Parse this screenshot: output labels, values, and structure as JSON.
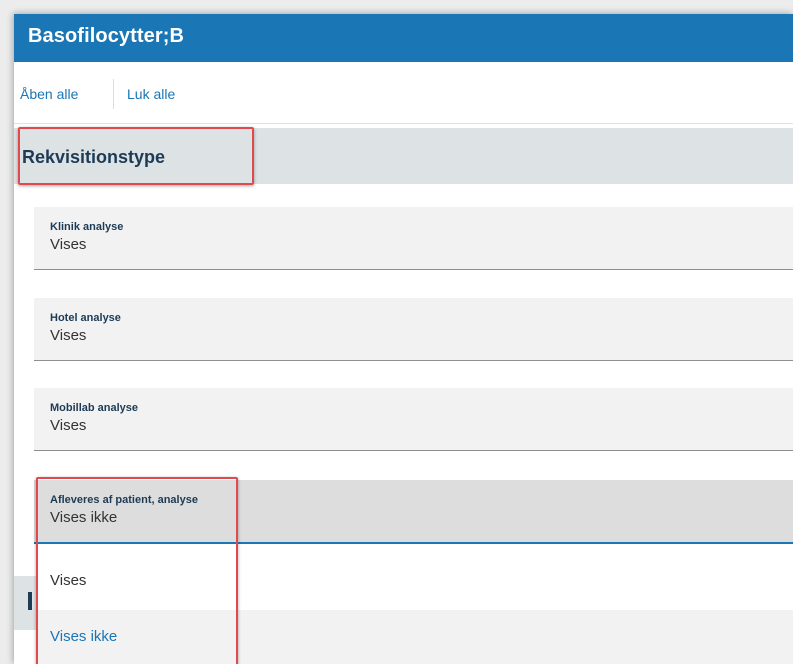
{
  "header": {
    "title": "Basofilocytter;B"
  },
  "toolbar": {
    "open_all": "Åben alle",
    "close_all": "Luk alle"
  },
  "section": {
    "title": "Rekvisitionstype"
  },
  "fields": [
    {
      "label": "Klinik analyse",
      "value": "Vises"
    },
    {
      "label": "Hotel analyse",
      "value": "Vises"
    },
    {
      "label": "Mobillab analyse",
      "value": "Vises"
    },
    {
      "label": "Afleveres af patient, analyse",
      "value": "Vises ikke"
    }
  ],
  "dropdown": {
    "options": [
      "Vises",
      "Vises ikke"
    ],
    "selected": "Vises ikke"
  },
  "colors": {
    "header": "#1a76b4",
    "link": "#1a76b4",
    "highlight": "#e04a4f",
    "section_bg": "#dde2e5"
  }
}
